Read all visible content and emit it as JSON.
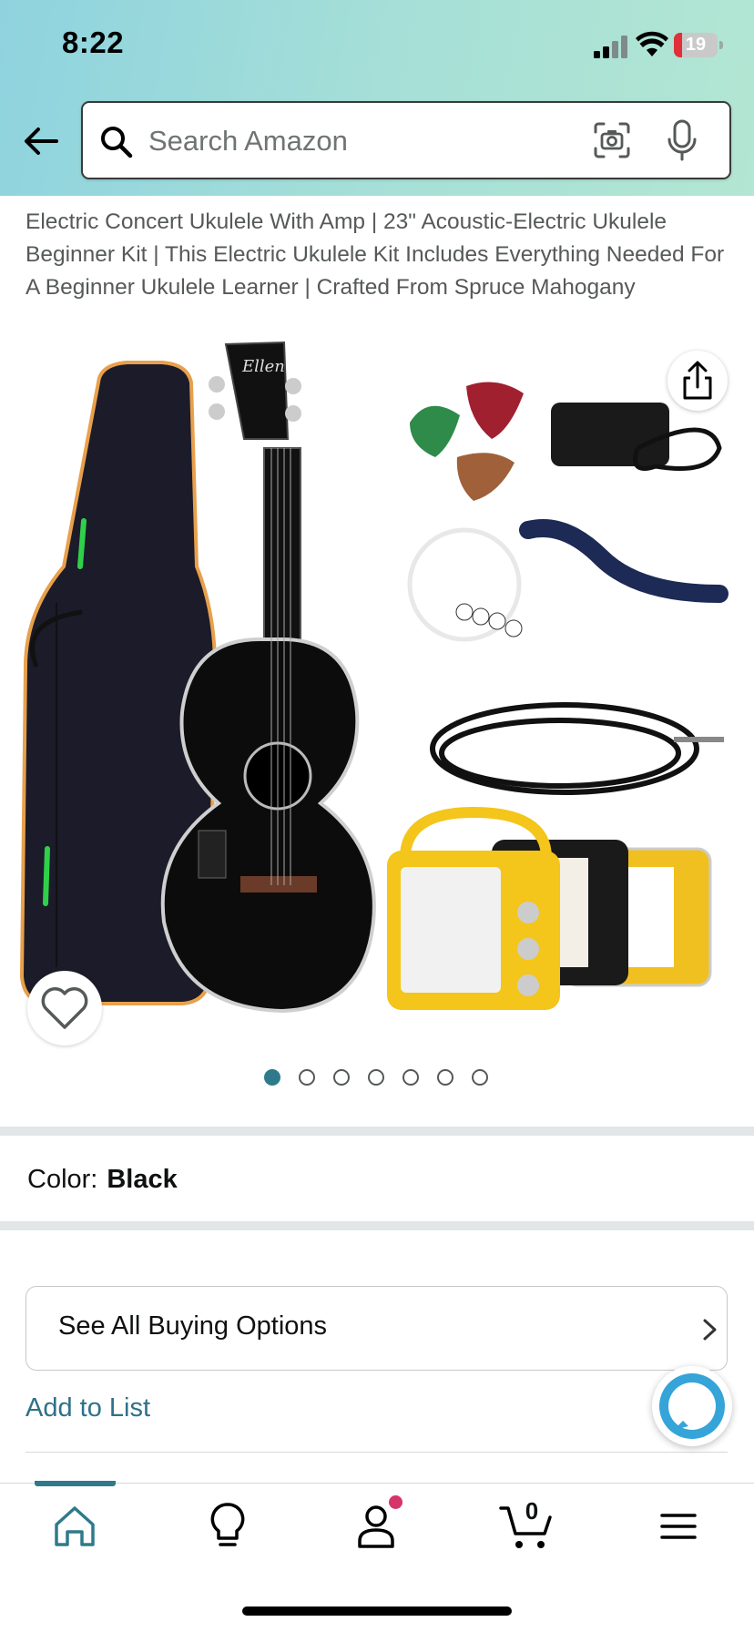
{
  "status_bar": {
    "time": "8:22",
    "battery": "19",
    "battery_level": 0.19
  },
  "search": {
    "placeholder": "Search Amazon"
  },
  "product": {
    "title": "Electric Concert Ukulele With Amp | 23\" Acoustic-Electric Ukulele Beginner Kit | This Electric Ukulele Kit Includes Everything Needed For A Beginner Ukulele Learner | Crafted From Spruce Mahogany",
    "image_brand_text": "Ellen"
  },
  "carousel": {
    "total": 7,
    "active_index": 0
  },
  "color": {
    "label": "Color:",
    "value": "Black"
  },
  "actions": {
    "buying_options": "See All Buying Options",
    "add_to_list": "Add to List"
  },
  "nav": {
    "cart_count": "0",
    "items": [
      "home-icon",
      "lightbulb-icon",
      "account-icon",
      "cart-icon",
      "menu-icon"
    ]
  },
  "colors": {
    "accent": "#2e7a8a",
    "link": "#2f7189",
    "badge": "#d6336c",
    "header_start": "#8fd3df",
    "header_end": "#b3e6d3"
  }
}
